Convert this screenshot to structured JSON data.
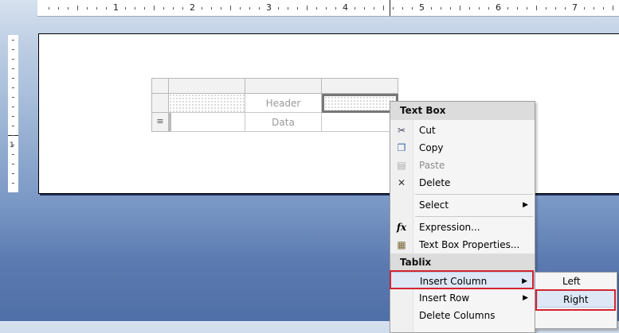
{
  "ruler": {
    "numbers": [
      "1",
      "2",
      "3",
      "4",
      "5",
      "6",
      "7"
    ],
    "v_number": "1"
  },
  "tablix": {
    "header_text": "Header",
    "data_text": "Data",
    "row_handle_glyph": "≡"
  },
  "context_menu": {
    "section1_title": "Text Box",
    "items1": [
      {
        "label": "Cut",
        "icon": "scissors-icon",
        "glyph": "✂"
      },
      {
        "label": "Copy",
        "icon": "copy-icon",
        "glyph": "❐"
      },
      {
        "label": "Paste",
        "icon": "paste-icon",
        "glyph": "▤"
      },
      {
        "label": "Delete",
        "icon": "delete-x-icon",
        "glyph": "✕"
      }
    ],
    "select_label": "Select",
    "expression_label": "Expression...",
    "expression_glyph": "fx",
    "properties_label": "Text Box Properties...",
    "properties_glyph": "▦",
    "section2_title": "Tablix",
    "insert_column_label": "Insert Column",
    "insert_row_label": "Insert Row",
    "delete_columns_label": "Delete Columns",
    "submenu_arrow": "▶"
  },
  "submenu": {
    "left_label": "Left",
    "right_label": "Right"
  },
  "colors": {
    "highlight_border": "#d2242f",
    "hover_fill": "#dde7f6"
  }
}
